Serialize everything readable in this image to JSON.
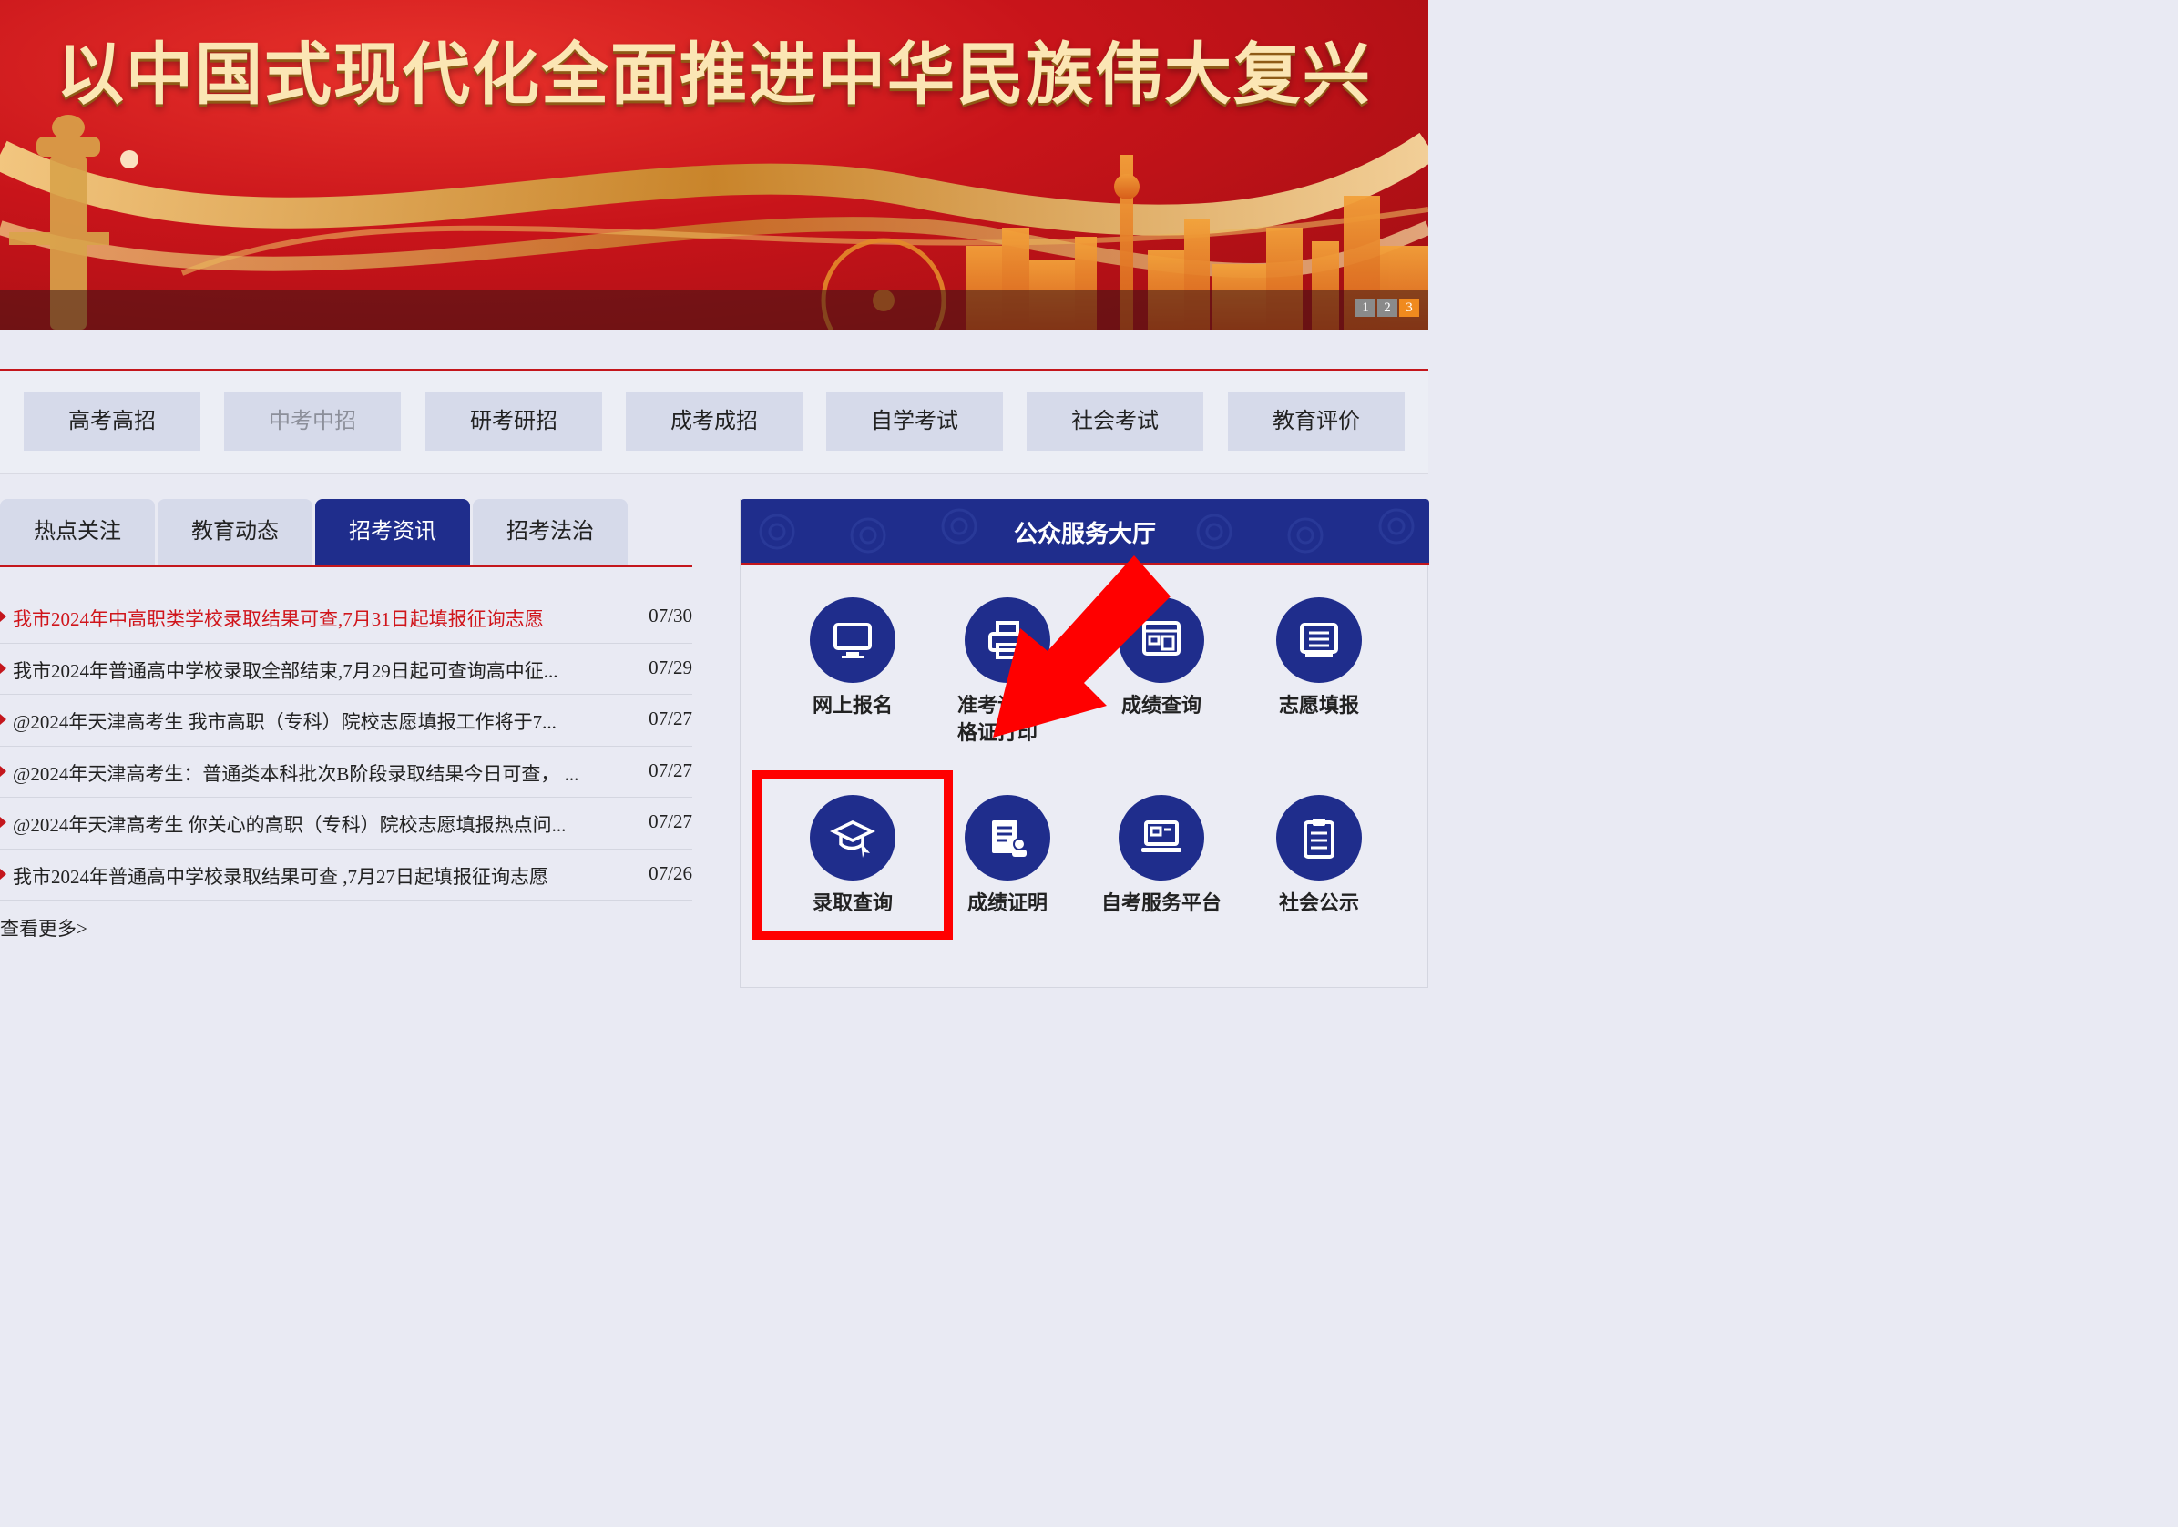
{
  "banner": {
    "title": "以中国式现代化全面推进中华民族伟大复兴",
    "pages": [
      "1",
      "2",
      "3"
    ],
    "active_page": "3"
  },
  "topnav": {
    "items": [
      "高考高招",
      "中考中招",
      "研考研招",
      "成考成招",
      "自学考试",
      "社会考试",
      "教育评价"
    ]
  },
  "tabs": [
    "热点关注",
    "教育动态",
    "招考资讯",
    "招考法治"
  ],
  "active_tab": "招考资讯",
  "news": [
    {
      "title": "我市2024年中高职类学校录取结果可查,7月31日起填报征询志愿",
      "date": "07/30"
    },
    {
      "title": "我市2024年普通高中学校录取全部结束,7月29日起可查询高中征...",
      "date": "07/29"
    },
    {
      "title": "@2024年天津高考生 我市高职（专科）院校志愿填报工作将于7...",
      "date": "07/27"
    },
    {
      "title": "@2024年天津高考生：普通类本科批次B阶段录取结果今日可查，  ...",
      "date": "07/27"
    },
    {
      "title": "@2024年天津高考生 你关心的高职（专科）院校志愿填报热点问...",
      "date": "07/27"
    },
    {
      "title": "我市2024年普通高中学校录取结果可查 ,7月27日起填报征询志愿",
      "date": "07/26"
    }
  ],
  "more_label": "查看更多>",
  "hall": {
    "title": "公众服务大厅",
    "services": [
      {
        "label": "网上报名",
        "icon": "monitor-icon"
      },
      {
        "label": "准考证/资格证打印",
        "icon": "printer-icon"
      },
      {
        "label": "成绩查询",
        "icon": "score-query-icon"
      },
      {
        "label": "志愿填报",
        "icon": "list-icon"
      },
      {
        "label": "录取查询",
        "icon": "graduation-cap-icon"
      },
      {
        "label": "成绩证明",
        "icon": "certificate-icon"
      },
      {
        "label": "自考服务平台",
        "icon": "laptop-icon"
      },
      {
        "label": "社会公示",
        "icon": "clipboard-icon"
      }
    ]
  },
  "annotation": {
    "box_color": "#ff0000",
    "arrow_color": "#ff0000"
  },
  "colors": {
    "brand_blue": "#1f2d8c",
    "accent_red": "#c4161c",
    "banner_text": "#fbe6b4"
  }
}
